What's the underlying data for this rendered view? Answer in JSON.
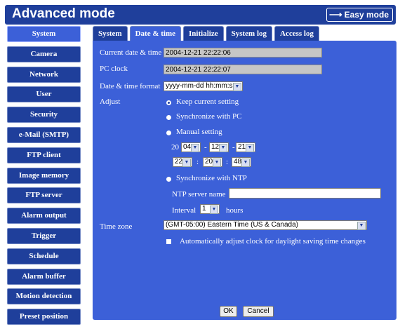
{
  "header": {
    "title": "Advanced mode",
    "easy_mode_button": "Easy mode",
    "easy_mode_icon": "arrow-right-icon"
  },
  "sidebar": {
    "items": [
      {
        "label": "System",
        "active": true
      },
      {
        "label": "Camera"
      },
      {
        "label": "Network"
      },
      {
        "label": "User"
      },
      {
        "label": "Security"
      },
      {
        "label": "e-Mail (SMTP)"
      },
      {
        "label": "FTP client"
      },
      {
        "label": "Image memory"
      },
      {
        "label": "FTP server"
      },
      {
        "label": "Alarm output"
      },
      {
        "label": "Trigger"
      },
      {
        "label": "Schedule"
      },
      {
        "label": "Alarm buffer"
      },
      {
        "label": "Motion detection"
      },
      {
        "label": "Preset position"
      }
    ]
  },
  "tabs": [
    {
      "label": "System"
    },
    {
      "label": "Date & time",
      "active": true
    },
    {
      "label": "Initialize"
    },
    {
      "label": "System log"
    },
    {
      "label": "Access log"
    }
  ],
  "form": {
    "current_label": "Current date & time",
    "current_value": "2004-12-21  22:22:06",
    "pc_label": "PC clock",
    "pc_value": "2004-12-21  22:22:07",
    "format_label": "Date & time format",
    "format_value": "yyyy-mm-dd hh:mm:ss",
    "adjust_label": "Adjust",
    "adjust_options": {
      "keep": "Keep current setting",
      "sync_pc": "Synchronize with PC",
      "manual": "Manual setting",
      "sync_ntp": "Synchronize with NTP"
    },
    "adjust_selected": "keep",
    "manual": {
      "year_prefix": "20",
      "year": "04",
      "month": "12",
      "day": "21",
      "hour": "22",
      "minute": "20",
      "second": "48",
      "date_sep": "-",
      "time_sep": ":"
    },
    "ntp_server_label": "NTP server name",
    "ntp_server_value": "",
    "interval_label": "Interval",
    "interval_value": "1",
    "interval_unit": "hours",
    "timezone_label": "Time zone",
    "timezone_value": "(GMT-05:00) Eastern Time (US & Canada)",
    "dst_label": "Automatically adjust clock for daylight saving time changes",
    "dst_checked": false
  },
  "buttons": {
    "ok": "OK",
    "cancel": "Cancel"
  },
  "colors": {
    "header_bg": "#1f3f9b",
    "panel_bg": "#3c60d8",
    "active_item": "#3c60d8"
  }
}
